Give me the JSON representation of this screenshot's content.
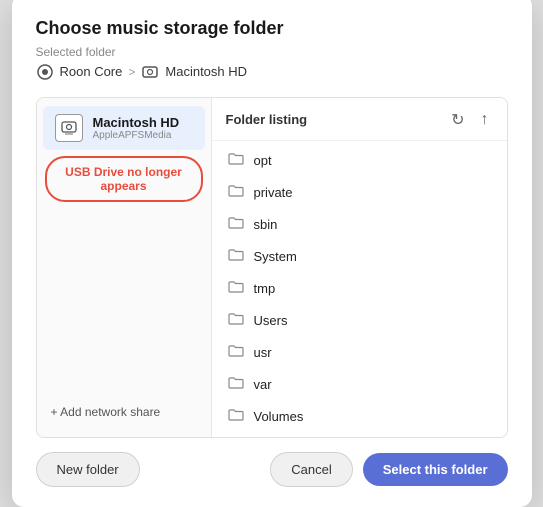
{
  "dialog": {
    "title": "Choose music storage folder",
    "selected_folder_label": "Selected folder",
    "breadcrumb": {
      "roon_core": "Roon Core",
      "separator": ">",
      "macintosh_hd": "Macintosh HD"
    }
  },
  "sidebar": {
    "macintosh_hd": {
      "name": "Macintosh HD",
      "sub": "AppleAPFSMedia"
    },
    "usb_warning": "USB Drive no longer appears",
    "add_network": "+ Add network share"
  },
  "folder_panel": {
    "title": "Folder listing",
    "folders": [
      {
        "name": "opt"
      },
      {
        "name": "private"
      },
      {
        "name": "sbin"
      },
      {
        "name": "System"
      },
      {
        "name": "tmp"
      },
      {
        "name": "Users"
      },
      {
        "name": "usr"
      },
      {
        "name": "var"
      },
      {
        "name": "Volumes"
      }
    ]
  },
  "footer": {
    "new_folder_label": "New folder",
    "cancel_label": "Cancel",
    "select_label": "Select this folder"
  },
  "icons": {
    "refresh": "↻",
    "up_arrow": "↑",
    "folder": "🗀",
    "roon_core": "⊞",
    "macintosh_hd": "⊟",
    "plus": "+"
  }
}
